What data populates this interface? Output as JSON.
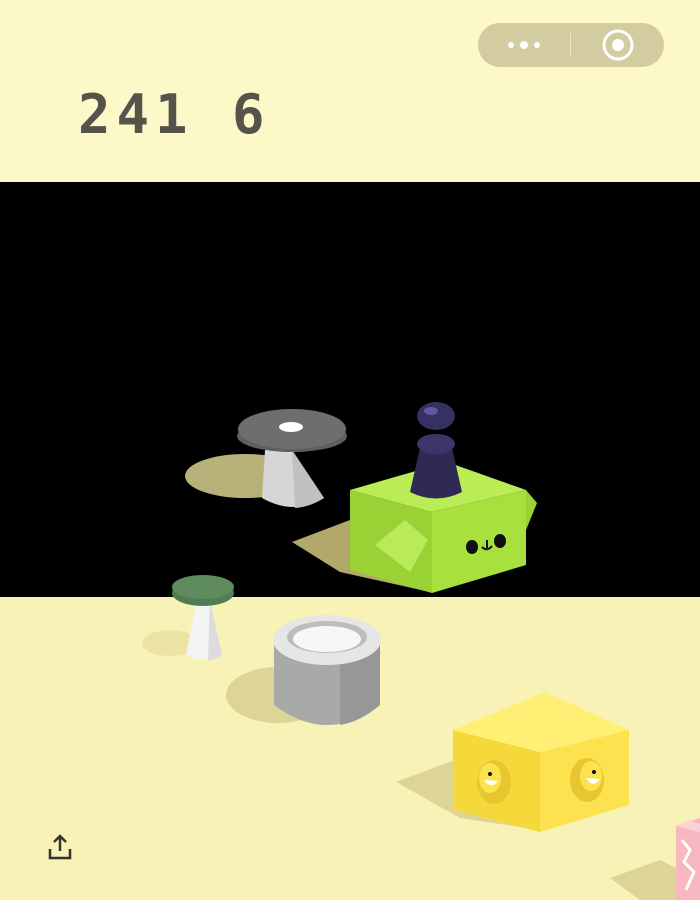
{
  "hud": {
    "score": "241 6",
    "capsule_menu_icon": "more-dots-icon",
    "capsule_close_icon": "target-circle-icon",
    "share_icon": "share-upload-icon"
  },
  "scene": {
    "background_color": "#f9f2b6",
    "void_color": "#000000",
    "player_color": "#2e2a55",
    "objects": [
      {
        "name": "gray-table-platform",
        "color": "#6e6e6e"
      },
      {
        "name": "green-face-box-platform",
        "color": "#a6df3c"
      },
      {
        "name": "green-stool-platform",
        "color": "#5f8c5f"
      },
      {
        "name": "gray-cylinder-platform",
        "color": "#a9a9a9"
      },
      {
        "name": "yellow-smile-box-platform",
        "color": "#fde24f"
      },
      {
        "name": "pink-box-platform",
        "color": "#f6b7c0"
      }
    ]
  }
}
